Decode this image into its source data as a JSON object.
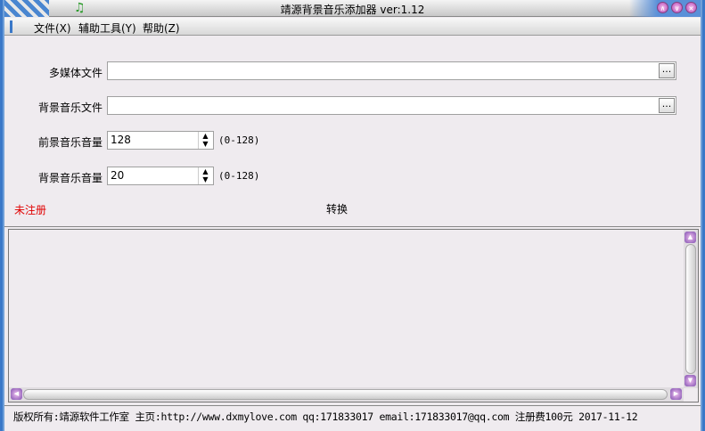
{
  "window": {
    "title": "靖源背景音乐添加器 ver:1.12",
    "min": "∧",
    "max": "∨",
    "close": "×"
  },
  "menu": [
    "文件(X)",
    "辅助工具(Y)",
    "帮助(Z)"
  ],
  "form": {
    "media_label": "多媒体文件",
    "media_value": "",
    "bgm_label": "背景音乐文件",
    "bgm_value": "",
    "browse": "...",
    "fg_vol_label": "前景音乐音量",
    "fg_vol_value": "128",
    "fg_range": "(0-128)",
    "bg_vol_label": "背景音乐音量",
    "bg_vol_value": "20",
    "bg_range": "(0-128)",
    "unregistered": "未注册",
    "convert": "转换"
  },
  "log": {
    "value": ""
  },
  "status": "版权所有:靖源软件工作室 主页:http://www.dxmylove.com qq:171833017 email:171833017@qq.com 注册费100元 2017-11-12",
  "colors": {
    "unregistered": "#e00000",
    "frame": "#3a78c8"
  }
}
